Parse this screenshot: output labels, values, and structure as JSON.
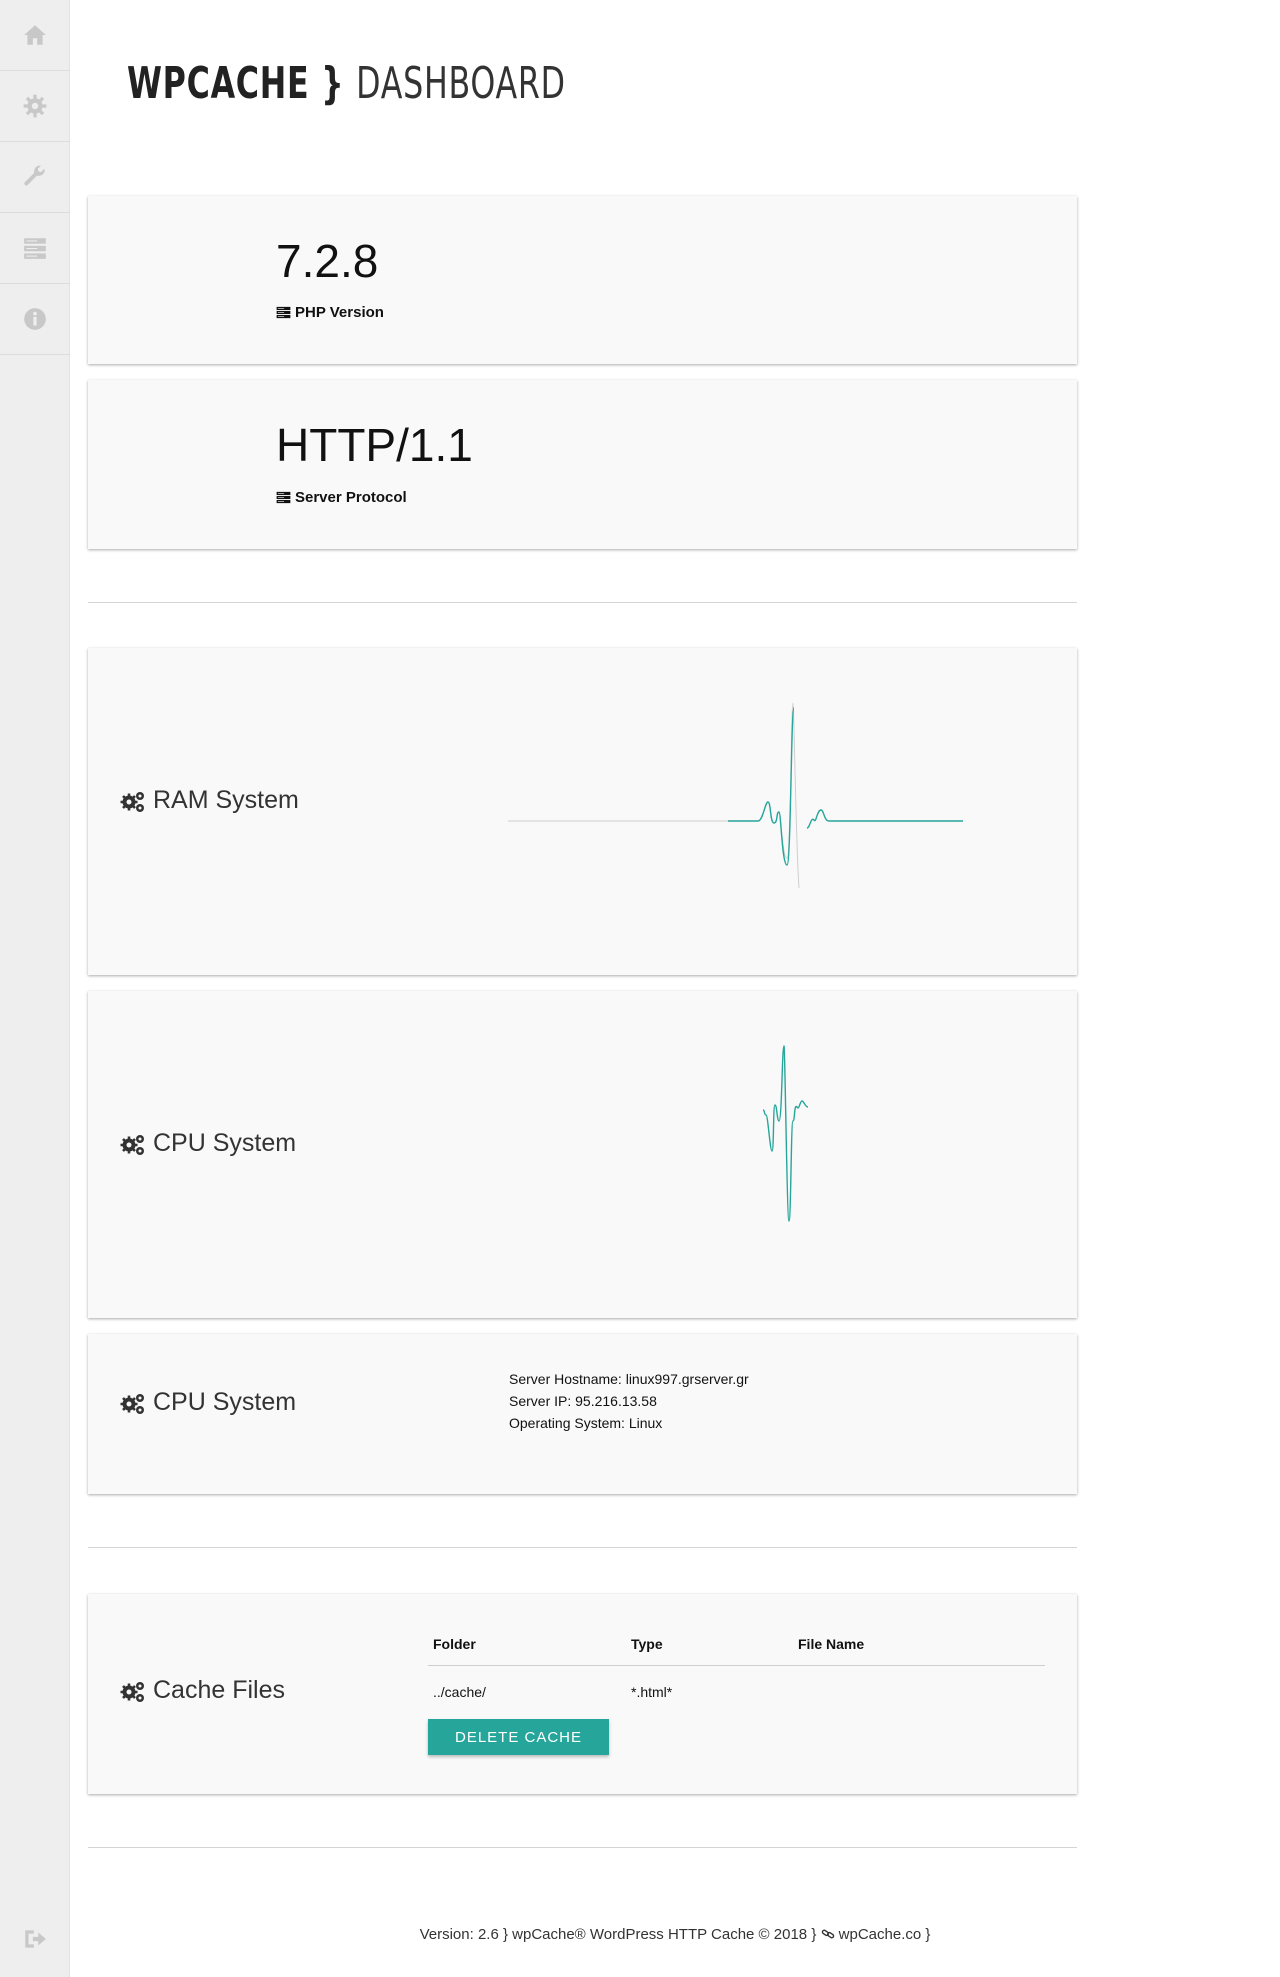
{
  "header": {
    "title_part1": "WPCACHE",
    "title_separator": "}",
    "title_part2": "DASHBOARD"
  },
  "sidebar": {
    "items": [
      {
        "icon": "home-icon"
      },
      {
        "icon": "gear-icon"
      },
      {
        "icon": "wrench-icon"
      },
      {
        "icon": "server-icon"
      },
      {
        "icon": "info-icon"
      }
    ],
    "bottom_icon": "sign-out-icon"
  },
  "stats": [
    {
      "value": "7.2.8",
      "label": "PHP Version",
      "icon": "server-icon"
    },
    {
      "value": "HTTP/1.1",
      "label": "Server Protocol",
      "icon": "server-icon"
    }
  ],
  "ram": {
    "title": "RAM System",
    "icon": "cogs-icon"
  },
  "cpu": {
    "title": "CPU System",
    "icon": "cogs-icon"
  },
  "server_info": {
    "title": "CPU System",
    "icon": "cogs-icon",
    "lines": [
      "Server Hostname: linux997.grserver.gr",
      "Server IP: 95.216.13.58",
      "Operating System: Linux"
    ]
  },
  "cache": {
    "title": "Cache Files",
    "icon": "cogs-icon",
    "columns": [
      "Folder",
      "Type",
      "File Name"
    ],
    "rows": [
      [
        "../cache/",
        "*.html*",
        ""
      ]
    ],
    "delete_button": "DELETE CACHE"
  },
  "footer": {
    "text": "Version: 2.6 } wpCache® WordPress HTTP Cache © 2018 }",
    "link": "wpCache.co }",
    "link_icon": "link-icon"
  },
  "colors": {
    "accent": "#26a69a",
    "card_bg": "#f9f9f9",
    "sidebar_bg": "#eeeeee",
    "icon_gray": "#c8c8c8"
  }
}
